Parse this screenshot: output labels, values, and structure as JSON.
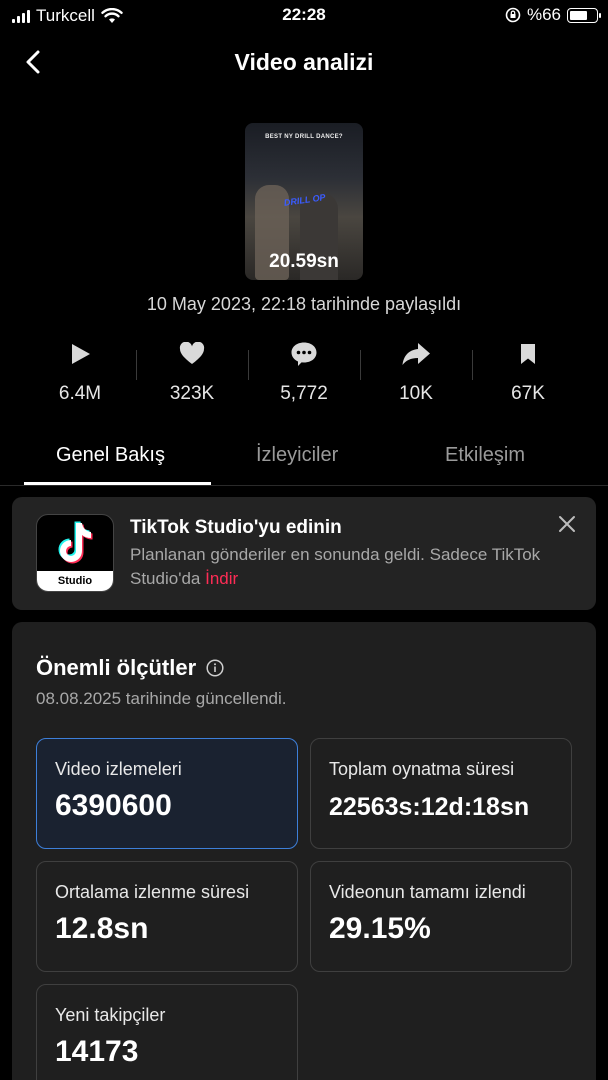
{
  "status_bar": {
    "carrier": "Turkcell",
    "time": "22:28",
    "battery": "%66",
    "battery_level": 0.66
  },
  "header": {
    "title": "Video analizi"
  },
  "video": {
    "thumbnail_caption": "BEST NY DRILL DANCE?",
    "thumbnail_logo": "DRILL OP",
    "duration": "20.59sn",
    "posted": "10 May 2023, 22:18 tarihinde paylaşıldı"
  },
  "stats": [
    {
      "icon": "play-icon",
      "value": "6.4M"
    },
    {
      "icon": "heart-icon",
      "value": "323K"
    },
    {
      "icon": "comment-icon",
      "value": "5,772"
    },
    {
      "icon": "share-icon",
      "value": "10K"
    },
    {
      "icon": "bookmark-icon",
      "value": "67K"
    }
  ],
  "tabs": [
    {
      "label": "Genel Bakış",
      "active": true
    },
    {
      "label": "İzleyiciler",
      "active": false
    },
    {
      "label": "Etkileşim",
      "active": false
    }
  ],
  "promo": {
    "app_label": "Studio",
    "title": "TikTok Studio'yu edinin",
    "body": "Planlanan gönderiler en sonunda geldi. Sadece TikTok Studio'da",
    "link": "İndir"
  },
  "metrics": {
    "title": "Önemli ölçütler",
    "updated": "08.08.2025 tarihinde güncellendi.",
    "tiles": [
      {
        "label": "Video izlemeleri",
        "value": "6390600"
      },
      {
        "label": "Toplam oynatma süresi",
        "value": "22563s:12d:18sn"
      },
      {
        "label": "Ortalama izlenme süresi",
        "value": "12.8sn"
      },
      {
        "label": "Videonun tamamı izlendi",
        "value": "29.15%"
      },
      {
        "label": "Yeni takipçiler",
        "value": "14173"
      }
    ]
  },
  "colors": {
    "accent_link": "#fe2c55",
    "selected_border": "#3d7fd9",
    "card_bg": "#1f1f1f"
  }
}
